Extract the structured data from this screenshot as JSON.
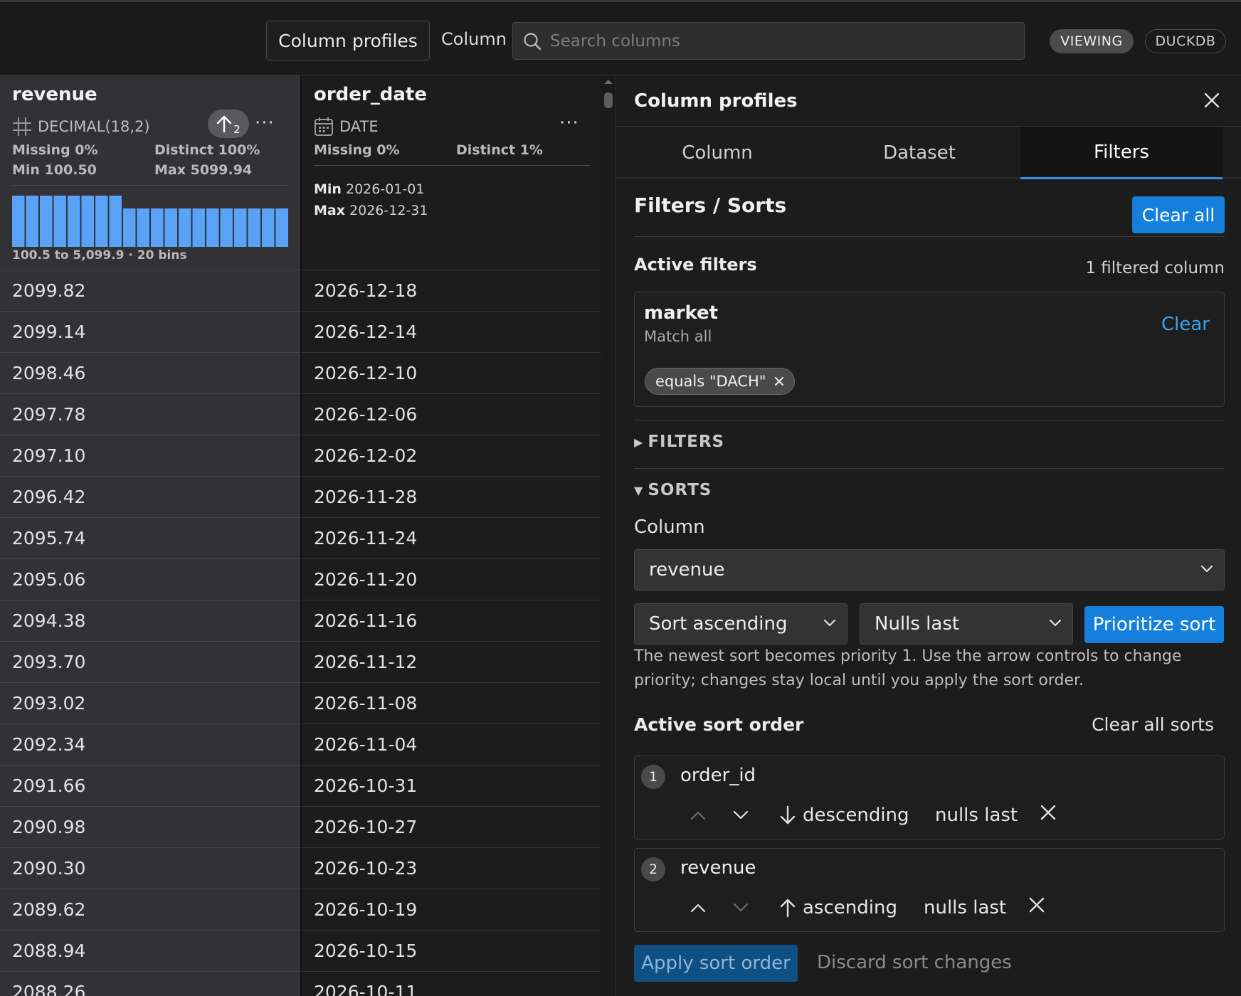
{
  "toolbar": {
    "profiles_button": "Column profiles",
    "column_label": "Column",
    "search_placeholder": "Search columns",
    "mode_badge": "VIEWING",
    "engine_badge": "DUCKDB"
  },
  "columns": [
    {
      "name": "revenue",
      "type_icon": "hash-icon",
      "type": "DECIMAL(18,2)",
      "sort_priority": "2",
      "missing": "Missing 0%",
      "distinct": "Distinct 100%",
      "min": "Min 100.50",
      "max": "Max 5099.94",
      "histogram_caption": "100.5 to 5,099.9 · 20 bins",
      "histogram_bins": [
        1,
        1,
        1,
        1,
        1,
        1,
        1,
        1,
        0.75,
        0.75,
        0.75,
        0.75,
        0.75,
        0.75,
        0.75,
        0.75,
        0.75,
        0.75,
        0.75,
        0.75
      ],
      "values": [
        "2099.82",
        "2099.14",
        "2098.46",
        "2097.78",
        "2097.10",
        "2096.42",
        "2095.74",
        "2095.06",
        "2094.38",
        "2093.70",
        "2093.02",
        "2092.34",
        "2091.66",
        "2090.98",
        "2090.30",
        "2089.62",
        "2088.94",
        "2088.26"
      ]
    },
    {
      "name": "order_date",
      "type_icon": "calendar-icon",
      "type": "DATE",
      "missing": "Missing 0%",
      "distinct": "Distinct 1%",
      "min_label": "Min",
      "min_value": "2026-01-01",
      "max_label": "Max",
      "max_value": "2026-12-31",
      "values": [
        "2026-12-18",
        "2026-12-14",
        "2026-12-10",
        "2026-12-06",
        "2026-12-02",
        "2026-11-28",
        "2026-11-24",
        "2026-11-20",
        "2026-11-16",
        "2026-11-12",
        "2026-11-08",
        "2026-11-04",
        "2026-10-31",
        "2026-10-27",
        "2026-10-23",
        "2026-10-19",
        "2026-10-15",
        "2026-10-11"
      ]
    }
  ],
  "panel": {
    "title": "Column profiles",
    "tabs": [
      "Column",
      "Dataset",
      "Filters"
    ],
    "active_tab": "Filters",
    "heading": "Filters / Sorts",
    "clear_all": "Clear all",
    "active_filters_title": "Active filters",
    "active_filters_count": "1 filtered column",
    "filter": {
      "column": "market",
      "mode": "Match all",
      "clear": "Clear",
      "chip": "equals \"DACH\""
    },
    "filters_section": "FILTERS",
    "sorts_section": "SORTS",
    "sort_column_label": "Column",
    "sort_column_value": "revenue",
    "sort_direction_value": "Sort ascending",
    "nulls_value": "Nulls last",
    "prioritize_button": "Prioritize sort",
    "help_text": "The newest sort becomes priority 1. Use the arrow controls to change priority; changes stay local until you apply the sort order.",
    "active_sort_title": "Active sort order",
    "clear_all_sorts": "Clear all sorts",
    "sorts": [
      {
        "priority": "1",
        "column": "order_id",
        "direction": "descending",
        "nulls": "nulls last"
      },
      {
        "priority": "2",
        "column": "revenue",
        "direction": "ascending",
        "nulls": "nulls last"
      }
    ],
    "apply_button": "Apply sort order",
    "discard_button": "Discard sort changes"
  },
  "colors": {
    "accent": "#1480dc",
    "histogram": "#5aa2f7",
    "link": "#3b9ff0"
  }
}
